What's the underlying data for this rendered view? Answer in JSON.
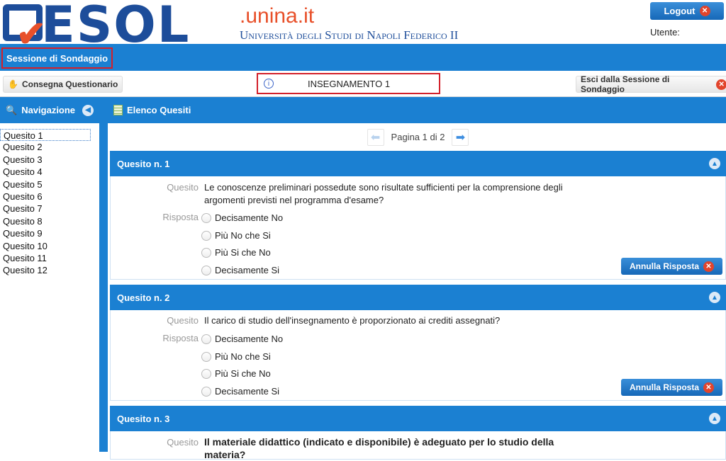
{
  "header": {
    "logo_text": "GESOL",
    "domain": ".unina.it",
    "university": "Università degli Studi di Napoli Federico II",
    "logout_label": "Logout",
    "user_label": "Utente:"
  },
  "session": {
    "title": "Sessione di Sondaggio"
  },
  "toolbar": {
    "deliver_label": "Consegna Questionario",
    "course": "INSEGNAMENTO 1",
    "exit_label": "Esci dalla Sessione di Sondaggio"
  },
  "nav": {
    "title": "Navigazione",
    "items": [
      "Quesito 1",
      "Quesito 2",
      "Quesito 3",
      "Quesito 4",
      "Quesito 5",
      "Quesito 6",
      "Quesito 7",
      "Quesito 8",
      "Quesito 9",
      "Quesito 10",
      "Quesito 11",
      "Quesito 12"
    ]
  },
  "main": {
    "title": "Elenco Quesiti",
    "pager": "Pagina 1 di 2",
    "question_label": "Quesito",
    "answer_label": "Risposta",
    "cancel_label": "Annulla Risposta",
    "options": [
      "Decisamente No",
      "Più No che Si",
      "Più Si che No",
      "Decisamente Si"
    ],
    "questions": [
      {
        "title": "Quesito n. 1",
        "text": "Le conoscenze preliminari possedute sono risultate sufficienti per la comprensione degli argomenti previsti nel programma d'esame?"
      },
      {
        "title": "Quesito n. 2",
        "text": "Il carico di studio dell'insegnamento è proporzionato ai crediti assegnati?"
      },
      {
        "title": "Quesito n. 3",
        "text": "Il materiale didattico (indicato e disponibile) è adeguato per lo studio della materia?"
      }
    ]
  },
  "colors": {
    "primary": "#1b80d2",
    "logo": "#1d4d9a",
    "accent": "#e8502a",
    "highlight": "#d3202a"
  }
}
